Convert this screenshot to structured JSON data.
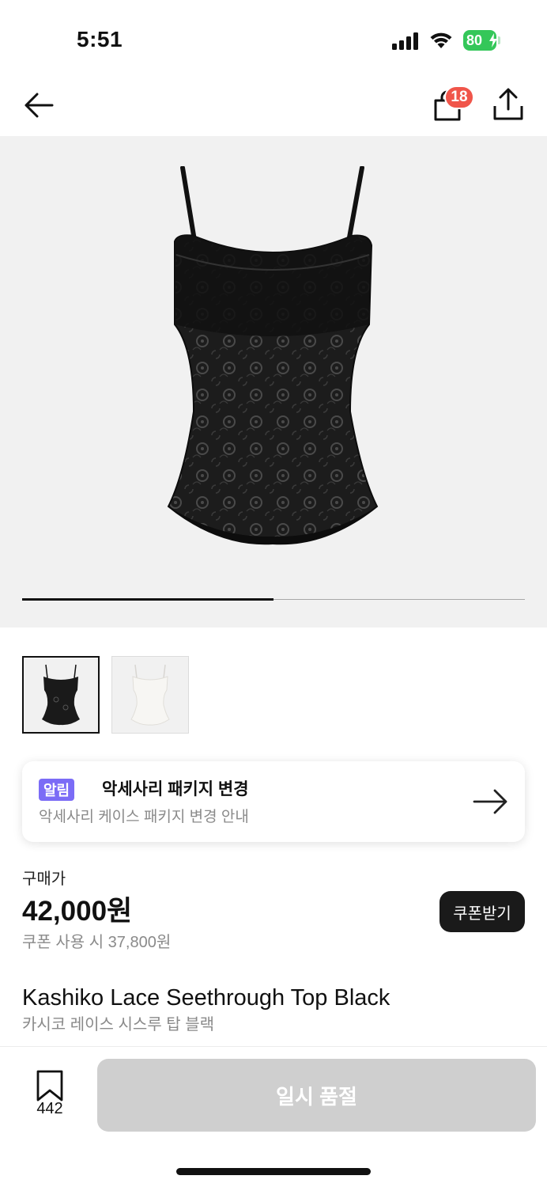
{
  "status_bar": {
    "time": "5:51",
    "battery": "80",
    "icons": [
      "signal-icon",
      "wifi-icon",
      "battery-icon",
      "charging-bolt-icon"
    ]
  },
  "nav": {
    "back_icon": "arrow-left-icon",
    "bag_icon": "shopping-bag-icon",
    "bag_count": "18",
    "share_icon": "share-icon"
  },
  "gallery": {
    "progress": 0.5,
    "thumbnails": [
      {
        "label": "black-variant",
        "selected": true
      },
      {
        "label": "white-variant",
        "selected": false
      }
    ]
  },
  "notice": {
    "badge": "알림",
    "title": "악세사리 패키지 변경",
    "subtitle": "악세사리 케이스 패키지 변경 안내",
    "arrow_icon": "arrow-right-icon"
  },
  "price": {
    "label": "구매가",
    "value": "42,000원",
    "coupon_price": "쿠폰 사용 시 37,800원",
    "coupon_button": "쿠폰받기"
  },
  "product": {
    "name": "Kashiko Lace Seethrough Top Black",
    "name_ko": "카시코 레이스 시스루 탑 블랙"
  },
  "bottom_bar": {
    "bookmark_icon": "bookmark-icon",
    "bookmark_count": "442",
    "buy_button": "일시 품절"
  },
  "colors": {
    "badge_red": "#f0554a",
    "notice_purple": "#7b6cf6",
    "disabled_gray": "#cfcfcf",
    "battery_green": "#34c759"
  }
}
